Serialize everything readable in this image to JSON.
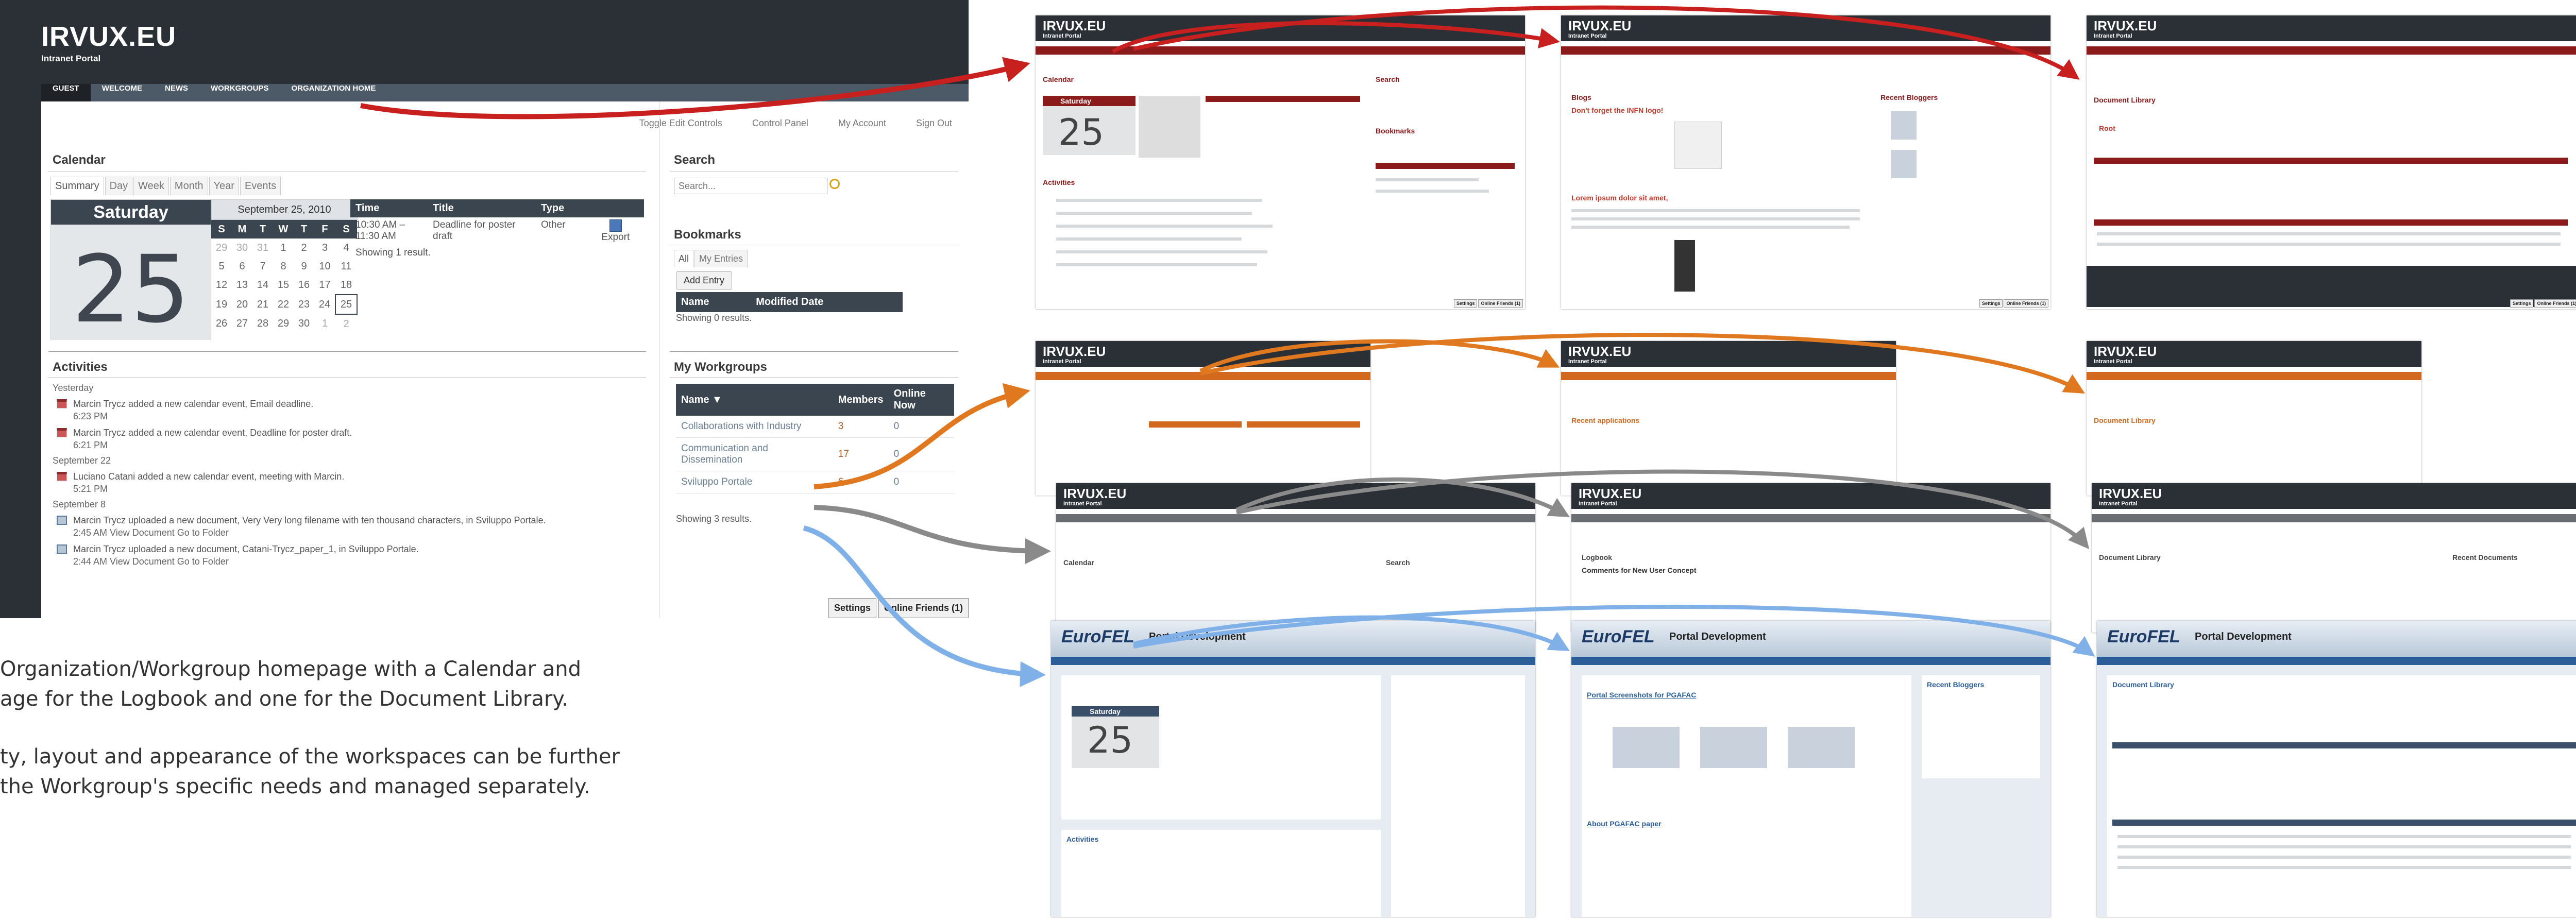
{
  "main": {
    "brand": "IRVUX.EU",
    "subtitle": "Intranet Portal",
    "nav": [
      "GUEST",
      "WELCOME",
      "NEWS",
      "WORKGROUPS",
      "ORGANIZATION HOME"
    ],
    "toplinks": [
      "Toggle Edit Controls",
      "Control Panel",
      "My Account",
      "Sign Out"
    ],
    "calendar": {
      "title": "Calendar",
      "tabs": [
        "Summary",
        "Day",
        "Week",
        "Month",
        "Year",
        "Events"
      ],
      "day_name": "Saturday",
      "day_number": "25",
      "month_title": "September 25, 2010",
      "weekdays": [
        "S",
        "M",
        "T",
        "W",
        "T",
        "F",
        "S"
      ],
      "weeks": [
        [
          "29",
          "30",
          "31",
          "1",
          "2",
          "3",
          "4"
        ],
        [
          "5",
          "6",
          "7",
          "8",
          "9",
          "10",
          "11"
        ],
        [
          "12",
          "13",
          "14",
          "15",
          "16",
          "17",
          "18"
        ],
        [
          "19",
          "20",
          "21",
          "22",
          "23",
          "24",
          "25"
        ],
        [
          "26",
          "27",
          "28",
          "29",
          "30",
          "1",
          "2"
        ]
      ],
      "event_headers": [
        "Time",
        "Title",
        "Type"
      ],
      "event": {
        "time": "10:30 AM – 11:30 AM",
        "title": "Deadline for poster draft",
        "type": "Other",
        "export": "Export"
      },
      "result": "Showing 1 result."
    },
    "activities": {
      "title": "Activities",
      "groups": [
        {
          "date": "Yesterday",
          "items": [
            {
              "icon": "calendar-icon",
              "text": "Marcin Trycz added a new calendar event, Email deadline.",
              "time": "6:23 PM"
            },
            {
              "icon": "calendar-icon",
              "text": "Marcin Trycz added a new calendar event, Deadline for poster draft.",
              "time": "6:21 PM"
            }
          ]
        },
        {
          "date": "September 22",
          "items": [
            {
              "icon": "calendar-icon",
              "text": "Luciano Catani added a new calendar event, meeting with Marcin.",
              "time": "5:21 PM"
            }
          ]
        },
        {
          "date": "September 8",
          "items": [
            {
              "icon": "document-icon",
              "text": "Marcin Trycz uploaded a new document, Very Very long filename with ten thousand characters, in Sviluppo Portale.",
              "time": "2:45 AM View Document Go to Folder"
            },
            {
              "icon": "document-icon",
              "text": "Marcin Trycz uploaded a new document, Catani-Trycz_paper_1, in Sviluppo Portale.",
              "time": "2:44 AM View Document Go to Folder"
            }
          ]
        }
      ]
    },
    "search": {
      "title": "Search",
      "placeholder": "Search..."
    },
    "bookmarks": {
      "title": "Bookmarks",
      "tabs": [
        "All",
        "My Entries"
      ],
      "add_button": "Add Entry",
      "headers": [
        "Name",
        "Modified Date"
      ],
      "result": "Showing 0 results."
    },
    "workgroups": {
      "title": "My Workgroups",
      "headers": [
        "Name ▼",
        "Members",
        "Online Now"
      ],
      "rows": [
        {
          "name": "Collaborations with Industry",
          "members": "3",
          "online": "0"
        },
        {
          "name": "Communication and Dissemination",
          "members": "17",
          "online": "0"
        },
        {
          "name": "Sviluppo Portale",
          "members": "6",
          "online": "0"
        }
      ],
      "result": "Showing 3 results."
    },
    "footer": [
      "Settings",
      "Online Friends (1)"
    ]
  },
  "caption": {
    "line1": "Organization/Workgroup homepage with a Calendar and",
    "line2": "age for the Logbook and one for the Document Library.",
    "line3": "ty, layout and appearance of the workspaces can be further",
    "line4": "the Workgroup's specific needs and managed separately."
  },
  "thumbs": {
    "brand": "IRVUX.EU",
    "subtitle": "Intranet Portal",
    "eurofel": "EuroFEL",
    "portal_dev": "Portal Development",
    "calendar_label": "Calendar",
    "search_label": "Search",
    "bookmarks_label": "Bookmarks",
    "activities_label": "Activities",
    "blogs_label": "Blogs",
    "blog_title": "Don't forget the INFN logo!",
    "blog_title2": "Lorem ipsum dolor sit amet,",
    "recent_bloggers": "Recent Bloggers",
    "doclib_label": "Document Library",
    "root_label": "Root",
    "applications_label": "Recent applications",
    "logbook_label": "Logbook",
    "logbook_post": "Comments for New User Concept",
    "pd_post": "Portal Screenshots for PGAFAC",
    "pd_post2": "About PGAFAC paper",
    "recent_docs": "Recent Documents",
    "day": "Saturday",
    "daynum": "25",
    "footer": [
      "Settings",
      "Online Friends (1)"
    ]
  },
  "colors": {
    "dark": "#2b3036",
    "navgray": "#4c5966",
    "red": "#8b1a1a",
    "orange": "#d2691e",
    "gray": "#6b6f73",
    "blue": "#2c5e9a"
  }
}
